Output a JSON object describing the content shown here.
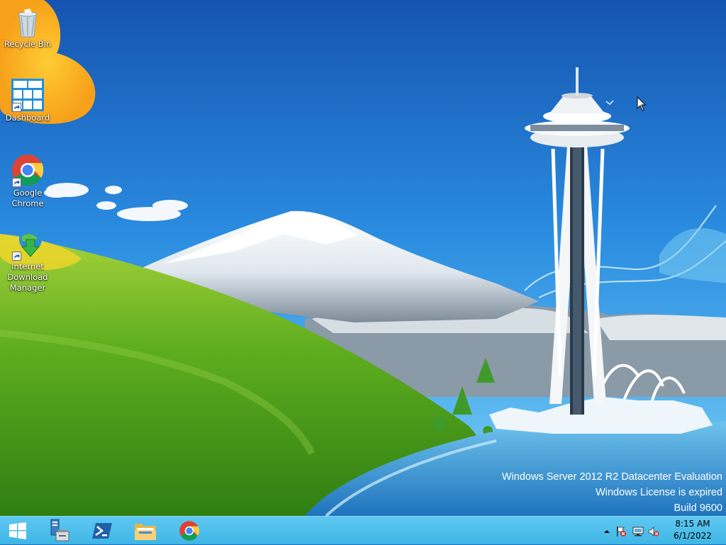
{
  "desktop": {
    "icons": [
      {
        "label": "Recycle Bin",
        "icon": "recycle-bin-icon"
      },
      {
        "label": "Dashboard",
        "icon": "dashboard-icon"
      },
      {
        "label": "Google Chrome",
        "icon": "chrome-icon"
      },
      {
        "label": "Internet Download Manager",
        "icon": "idm-icon"
      }
    ],
    "watermark": {
      "edition": "Windows Server 2012 R2 Datacenter Evaluation",
      "license": "Windows License is expired",
      "build": "Build 9600"
    }
  },
  "taskbar": {
    "pinned": [
      {
        "name": "start-button",
        "icon": "windows-logo-icon"
      },
      {
        "name": "server-manager",
        "icon": "server-manager-icon"
      },
      {
        "name": "powershell",
        "icon": "powershell-icon"
      },
      {
        "name": "file-explorer",
        "icon": "folder-icon"
      },
      {
        "name": "google-chrome",
        "icon": "chrome-icon"
      }
    ],
    "tray": {
      "icons": [
        "show-hidden-icons-icon",
        "action-center-flag-icon",
        "network-icon",
        "volume-muted-icon"
      ],
      "time": "8:15 AM",
      "date": "6/1/2022"
    }
  },
  "colors": {
    "taskbar": "#4bbfea",
    "sky": "#1d6fc4",
    "hill": "#5fae1f",
    "water": "#3d9ad6"
  }
}
